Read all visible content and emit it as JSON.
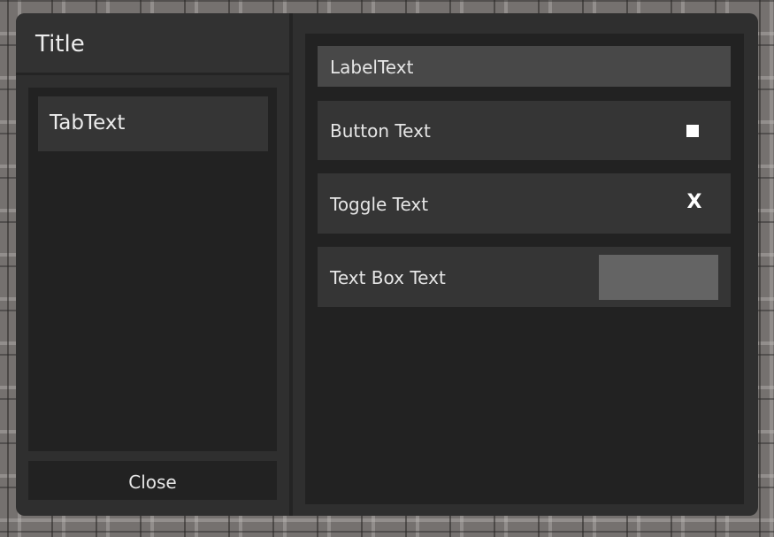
{
  "window": {
    "title": "Title"
  },
  "tabs": [
    {
      "label": "TabText"
    }
  ],
  "close_label": "Close",
  "content": {
    "label_text": "LabelText",
    "button": {
      "label": "Button Text",
      "icon": "square-icon"
    },
    "toggle": {
      "label": "Toggle Text",
      "state_glyph": "X"
    },
    "textbox": {
      "label": "Text Box Text",
      "value": "",
      "placeholder": ""
    }
  },
  "colors": {
    "window_bg": "#2f2f2f",
    "panel_bg": "#222222",
    "row_bg": "#353535",
    "label_row_bg": "#484848",
    "input_bg": "#646464",
    "text": "#e6e6e6"
  }
}
